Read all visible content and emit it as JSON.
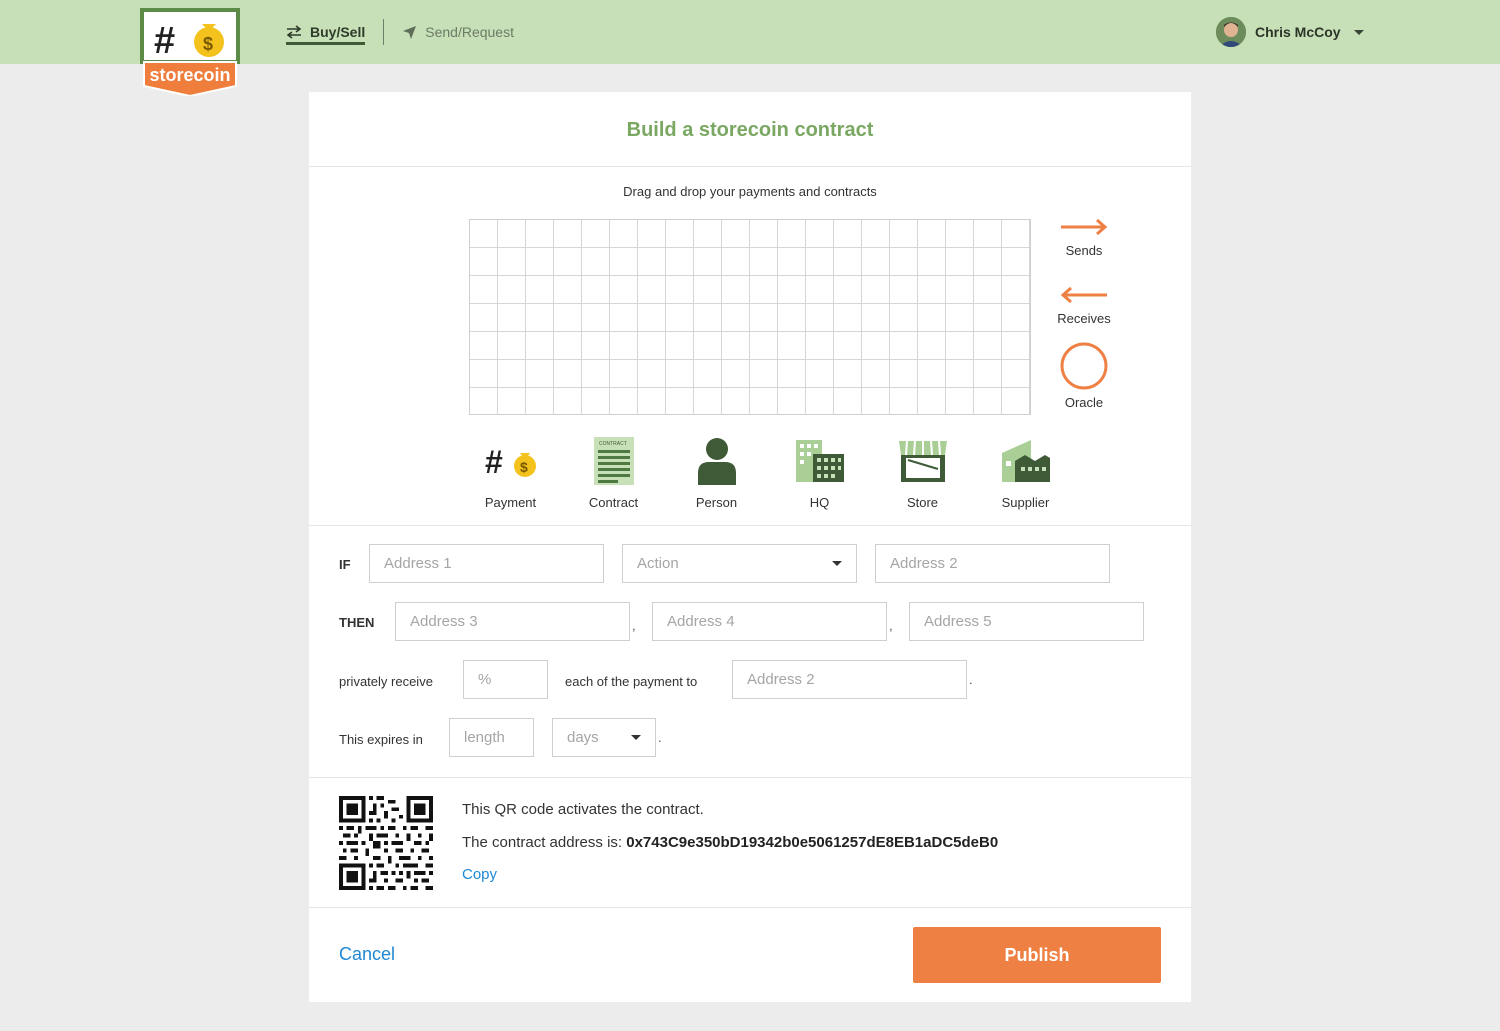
{
  "header": {
    "logo_text": "storecoin",
    "nav": [
      {
        "label": "Buy/Sell",
        "icon": "swap-arrows-icon",
        "active": true
      },
      {
        "label": "Send/Request",
        "icon": "paper-plane-icon",
        "active": false
      }
    ],
    "user": {
      "name": "Chris McCoy"
    }
  },
  "card": {
    "title": "Build a storecoin contract",
    "drag_hint": "Drag and drop your payments and contracts",
    "legend": [
      {
        "label": "Sends",
        "icon": "arrow-right-icon"
      },
      {
        "label": "Receives",
        "icon": "arrow-left-icon"
      },
      {
        "label": "Oracle",
        "icon": "circle-icon"
      }
    ],
    "palette": [
      {
        "label": "Payment",
        "icon": "payment-icon"
      },
      {
        "label": "Contract",
        "icon": "contract-icon",
        "icon_text": "CONTRACT"
      },
      {
        "label": "Person",
        "icon": "person-icon"
      },
      {
        "label": "HQ",
        "icon": "hq-building-icon"
      },
      {
        "label": "Store",
        "icon": "store-icon"
      },
      {
        "label": "Supplier",
        "icon": "supplier-icon"
      }
    ],
    "colors": {
      "accent": "#ef8043",
      "brand_green": "#7aa862",
      "dark_green": "#3f5a37",
      "link": "#1e88d4"
    }
  },
  "form": {
    "if_label": "IF",
    "then_label": "THEN",
    "address1_placeholder": "Address 1",
    "action_placeholder": "Action",
    "address2_placeholder": "Address 2",
    "address3_placeholder": "Address 3",
    "address4_placeholder": "Address 4",
    "address5_placeholder": "Address 5",
    "privately_receive_label": "privately receive",
    "percent_placeholder": "%",
    "each_payment_label": "each of the payment to",
    "payment_address_placeholder": "Address 2",
    "expires_label": "This expires in",
    "length_placeholder": "length",
    "unit_placeholder": "days",
    "comma": ",",
    "period": "."
  },
  "qr": {
    "activates_text": "This QR code activates the contract.",
    "address_prefix": "The contract address is:",
    "address": "0x743C9e350bD19342b0e5061257dE8EB1aDC5deB0",
    "copy_label": "Copy"
  },
  "footer": {
    "cancel_label": "Cancel",
    "publish_label": "Publish"
  }
}
